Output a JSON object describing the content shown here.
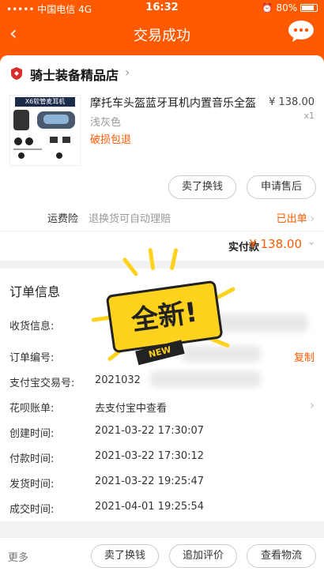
{
  "status": {
    "carrier": "中国电信",
    "network": "4G",
    "time": "16:32",
    "battery": "80%"
  },
  "nav": {
    "title": "交易成功"
  },
  "shop": {
    "name": "骑士装备精品店"
  },
  "product": {
    "thumb_caption": "X6软管麦耳机",
    "title": "摩托车头盔蓝牙耳机内置音乐全盔",
    "price": "¥ 138.00",
    "qty": "x1",
    "variant": "浅灰色",
    "tag": "破损包退"
  },
  "actions": {
    "sell": "卖了换钱",
    "after_sale": "申请售后"
  },
  "insurance": {
    "label": "运费险",
    "note": "退换货可自动理赔",
    "status": "已出单"
  },
  "total": {
    "label": "实付款",
    "value": "¥ 138.00"
  },
  "order": {
    "title": "订单信息",
    "rows": [
      {
        "label": "收货信息:",
        "value": ""
      },
      {
        "label": "订单编号:",
        "value": ""
      },
      {
        "label": "支付宝交易号:",
        "value": "2021032"
      },
      {
        "label": "花呗账单:",
        "value": "去支付宝中查看"
      },
      {
        "label": "创建时间:",
        "value": "2021-03-22 17:30:07"
      },
      {
        "label": "付款时间:",
        "value": "2021-03-22 17:30:12"
      },
      {
        "label": "发货时间:",
        "value": "2021-03-22 19:25:47"
      },
      {
        "label": "成交时间:",
        "value": "2021-04-01 19:25:54"
      }
    ],
    "copy": "复制"
  },
  "sticker": {
    "text": "全新!",
    "badge": "NEW"
  },
  "bottom": {
    "more": "更多",
    "sell": "卖了换钱",
    "review": "追加评价",
    "logistics": "查看物流"
  },
  "colors": {
    "accent": "#ff5a00",
    "sticker": "#ffd21e"
  }
}
